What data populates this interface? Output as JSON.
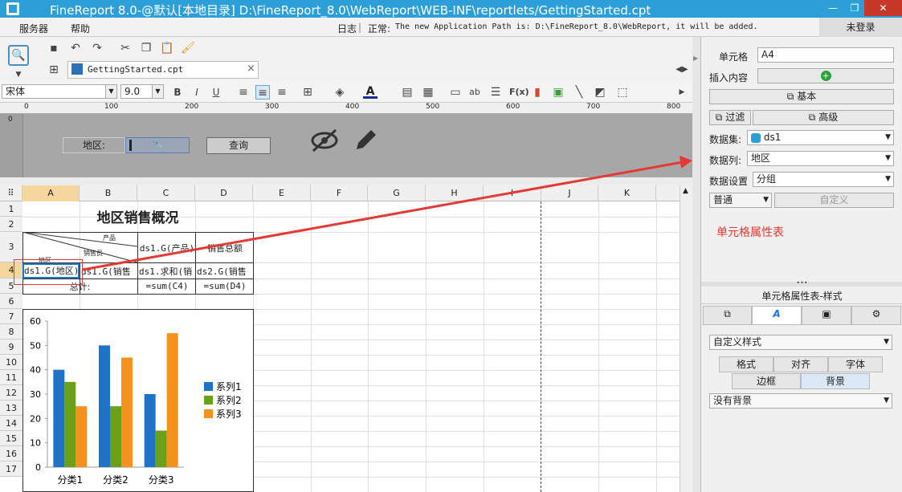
{
  "window": {
    "title": "FineReport 8.0-@默认[本地目录]    D:\\FineReport_8.0\\WebReport\\WEB-INF\\reportlets/GettingStarted.cpt",
    "minimize": "—",
    "restore": "❐",
    "close": "✕"
  },
  "menu": {
    "server": "服务器",
    "help": "帮助",
    "log": "日志",
    "status": "正常:",
    "status_msg": "The new  Application Path is: D:\\FineReport_8.0\\WebReport, it will be added.",
    "login": "未登录"
  },
  "tab": {
    "file": "GettingStarted.cpt",
    "close": "×"
  },
  "format": {
    "font": "宋体",
    "size": "9.0",
    "bold": "B",
    "italic": "I",
    "underline": "U"
  },
  "ruler": [
    "0",
    "100",
    "200",
    "300",
    "400",
    "500",
    "600",
    "700",
    "800"
  ],
  "param": {
    "region_label": "地区:",
    "query_button": "查询",
    "ruler_zero": "0"
  },
  "sheet": {
    "columns": [
      "A",
      "B",
      "C",
      "D",
      "E",
      "F",
      "G",
      "H",
      "I",
      "J",
      "K"
    ],
    "rows": [
      "1",
      "2",
      "3",
      "4",
      "5",
      "6",
      "7",
      "8",
      "9",
      "10",
      "11",
      "12",
      "13",
      "14",
      "15",
      "16",
      "17"
    ],
    "title": "地区销售概况",
    "diag_product": "产品",
    "diag_sales": "销售员",
    "diag_region": "地区",
    "c3": "ds1.G(产品)",
    "d3": "销售总额",
    "a4": "ds1.G(地区)",
    "b4": "ds1.G(销售",
    "c4": "ds1.求和(销",
    "d4": "ds2.G(销售",
    "b5": "总计:",
    "c5": "=sum(C4)",
    "d5": "=sum(D4)"
  },
  "chart_data": {
    "type": "bar",
    "categories": [
      "分类1",
      "分类2",
      "分类3"
    ],
    "series": [
      {
        "name": "系列1",
        "values": [
          40,
          50,
          30
        ],
        "color": "#1f73c6"
      },
      {
        "name": "系列2",
        "values": [
          35,
          25,
          15
        ],
        "color": "#6aa118"
      },
      {
        "name": "系列3",
        "values": [
          25,
          45,
          55
        ],
        "color": "#f5921e"
      }
    ],
    "ylim": [
      0,
      60
    ],
    "yticks": [
      "0",
      "10",
      "20",
      "30",
      "40",
      "50",
      "60"
    ],
    "legend": "right"
  },
  "panel": {
    "cell_label": "单元格",
    "cell_value": "A4",
    "insert_label": "插入内容",
    "basic": "基本",
    "filter": "过滤",
    "advanced": "高级",
    "dataset_label": "数据集:",
    "dataset_value": "ds1",
    "column_label": "数据列:",
    "column_value": "地区",
    "setting_label": "数据设置",
    "setting_value": "分组",
    "normal": "普通",
    "custom": "自定义",
    "annotation": "单元格属性表",
    "style_title": "单元格属性表-样式",
    "style_value": "自定义样式",
    "sub_format": "格式",
    "sub_align": "对齐",
    "sub_font": "字体",
    "sub_border": "边框",
    "sub_bg": "背景",
    "bg_value": "没有背景"
  },
  "colors": {
    "title": "#2c9fd9",
    "accent": "#e53935",
    "select": "#1976d2"
  }
}
